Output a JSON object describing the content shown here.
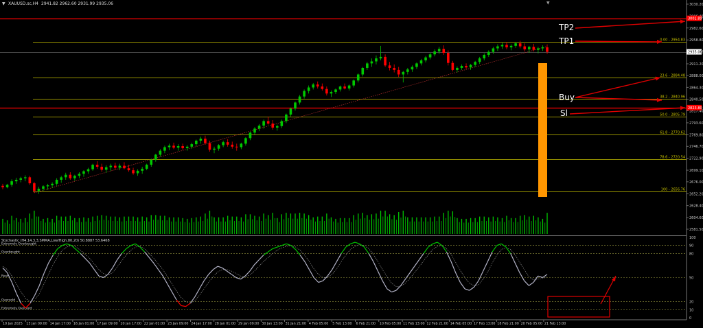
{
  "header": {
    "symbol_text": "XAUUSD.sc,H4",
    "ohlc_text": "2941.82 2962.60 2931.99 2935.06"
  },
  "chart_data": {
    "type": "candlestick",
    "price_axis": {
      "ticks": [
        "3030.20",
        "3006.40",
        "2982.60",
        "2958.80",
        "2935.06",
        "2911.20",
        "2888.00",
        "2864.30",
        "2840.50",
        "2817.40",
        "2793.60",
        "2769.80",
        "2746.70",
        "2722.90",
        "2699.10",
        "2676.00",
        "2652.20",
        "2628.40",
        "2604.60",
        "2581.50"
      ]
    },
    "current_price_label": "2935.06",
    "tp2_price_label": "3001.89",
    "sl_price_label": "2823.80",
    "fib_levels": [
      {
        "label": "0.00 - 2954.83",
        "price": 2954.8
      },
      {
        "label": "23.6 - 2884.48",
        "price": 2884.5
      },
      {
        "label": "38.2 - 2840.96",
        "price": 2840.96
      },
      {
        "label": "50.0 - 2805.79",
        "price": 2805.8
      },
      {
        "label": "61.8 - 2770.62",
        "price": 2770.6
      },
      {
        "label": "78.6 - 2720.54",
        "price": 2720.5
      },
      {
        "label": "100 - 2656.76",
        "price": 2656.8
      }
    ],
    "time_axis": {
      "labels": [
        "10 Jan 2025",
        "13 Jan 09:00",
        "14 Jan 17:00",
        "16 Jan 01:00",
        "17 Jan 09:00",
        "20 Jan 17:00",
        "22 Jan 01:00",
        "23 Jan 09:00",
        "24 Jan 17:00",
        "28 Jan 01:00",
        "29 Jan 09:00",
        "30 Jan 13:00",
        "31 Jan 21:00",
        "4 Feb 05:00",
        "5 Feb 13:00",
        "6 Feb 21:00",
        "10 Feb 05:00",
        "11 Feb 13:00",
        "12 Feb 21:00",
        "14 Feb 05:00",
        "17 Feb 13:00",
        "18 Feb 21:00",
        "20 Feb 05:00",
        "21 Feb 13:00"
      ]
    },
    "candles": [
      [
        2668,
        2672,
        2661,
        2665
      ],
      [
        2665,
        2672,
        2663,
        2670
      ],
      [
        2670,
        2681,
        2666,
        2677
      ],
      [
        2677,
        2684,
        2672,
        2680
      ],
      [
        2680,
        2686,
        2675,
        2683
      ],
      [
        2683,
        2689,
        2677,
        2685
      ],
      [
        2685,
        2688,
        2670,
        2673
      ],
      [
        2673,
        2676,
        2654,
        2658
      ],
      [
        2658,
        2666,
        2652,
        2662
      ],
      [
        2662,
        2669,
        2658,
        2667
      ],
      [
        2667,
        2672,
        2660,
        2669
      ],
      [
        2669,
        2675,
        2664,
        2672
      ],
      [
        2672,
        2683,
        2668,
        2680
      ],
      [
        2680,
        2688,
        2674,
        2685
      ],
      [
        2685,
        2694,
        2680,
        2690
      ],
      [
        2690,
        2695,
        2680,
        2683
      ],
      [
        2683,
        2690,
        2678,
        2688
      ],
      [
        2688,
        2695,
        2683,
        2692
      ],
      [
        2692,
        2699,
        2686,
        2697
      ],
      [
        2697,
        2704,
        2692,
        2701
      ],
      [
        2701,
        2712,
        2698,
        2710
      ],
      [
        2710,
        2717,
        2702,
        2706
      ],
      [
        2706,
        2712,
        2696,
        2700
      ],
      [
        2700,
        2709,
        2694,
        2705
      ],
      [
        2705,
        2712,
        2698,
        2708
      ],
      [
        2708,
        2714,
        2700,
        2704
      ],
      [
        2704,
        2712,
        2699,
        2708
      ],
      [
        2708,
        2715,
        2701,
        2703
      ],
      [
        2703,
        2710,
        2696,
        2699
      ],
      [
        2699,
        2704,
        2690,
        2693
      ],
      [
        2693,
        2701,
        2688,
        2698
      ],
      [
        2698,
        2706,
        2692,
        2702
      ],
      [
        2702,
        2712,
        2699,
        2710
      ],
      [
        2710,
        2722,
        2706,
        2720
      ],
      [
        2720,
        2732,
        2716,
        2730
      ],
      [
        2730,
        2741,
        2726,
        2738
      ],
      [
        2738,
        2748,
        2733,
        2745
      ],
      [
        2745,
        2752,
        2739,
        2748
      ],
      [
        2748,
        2754,
        2741,
        2744
      ],
      [
        2744,
        2751,
        2738,
        2747
      ],
      [
        2747,
        2752,
        2740,
        2743
      ],
      [
        2743,
        2749,
        2738,
        2746
      ],
      [
        2746,
        2754,
        2742,
        2751
      ],
      [
        2751,
        2760,
        2747,
        2758
      ],
      [
        2758,
        2766,
        2752,
        2762
      ],
      [
        2762,
        2768,
        2750,
        2753
      ],
      [
        2753,
        2758,
        2736,
        2740
      ],
      [
        2740,
        2746,
        2733,
        2742
      ],
      [
        2742,
        2751,
        2738,
        2749
      ],
      [
        2749,
        2758,
        2745,
        2755
      ],
      [
        2755,
        2761,
        2746,
        2750
      ],
      [
        2750,
        2756,
        2742,
        2746
      ],
      [
        2746,
        2752,
        2738,
        2745
      ],
      [
        2745,
        2754,
        2741,
        2752
      ],
      [
        2752,
        2765,
        2748,
        2763
      ],
      [
        2763,
        2776,
        2759,
        2774
      ],
      [
        2774,
        2785,
        2770,
        2782
      ],
      [
        2782,
        2791,
        2777,
        2788
      ],
      [
        2788,
        2800,
        2782,
        2797
      ],
      [
        2797,
        2806,
        2790,
        2792
      ],
      [
        2792,
        2799,
        2780,
        2784
      ],
      [
        2784,
        2790,
        2778,
        2787
      ],
      [
        2787,
        2800,
        2783,
        2797
      ],
      [
        2797,
        2812,
        2793,
        2810
      ],
      [
        2810,
        2824,
        2806,
        2822
      ],
      [
        2822,
        2836,
        2818,
        2834
      ],
      [
        2834,
        2849,
        2830,
        2846
      ],
      [
        2846,
        2860,
        2842,
        2857
      ],
      [
        2857,
        2868,
        2852,
        2864
      ],
      [
        2864,
        2873,
        2860,
        2870
      ],
      [
        2870,
        2876,
        2862,
        2866
      ],
      [
        2866,
        2872,
        2858,
        2861
      ],
      [
        2861,
        2866,
        2848,
        2852
      ],
      [
        2852,
        2858,
        2845,
        2855
      ],
      [
        2855,
        2862,
        2851,
        2860
      ],
      [
        2860,
        2868,
        2856,
        2866
      ],
      [
        2866,
        2872,
        2860,
        2862
      ],
      [
        2862,
        2870,
        2858,
        2868
      ],
      [
        2868,
        2880,
        2864,
        2878
      ],
      [
        2878,
        2892,
        2874,
        2890
      ],
      [
        2890,
        2905,
        2886,
        2903
      ],
      [
        2903,
        2915,
        2899,
        2912
      ],
      [
        2912,
        2922,
        2905,
        2916
      ],
      [
        2916,
        2928,
        2910,
        2922
      ],
      [
        2922,
        2947,
        2918,
        2925
      ],
      [
        2925,
        2930,
        2905,
        2908
      ],
      [
        2908,
        2915,
        2898,
        2903
      ],
      [
        2903,
        2910,
        2894,
        2899
      ],
      [
        2899,
        2905,
        2885,
        2890
      ],
      [
        2890,
        2897,
        2874,
        2895
      ],
      [
        2895,
        2903,
        2890,
        2900
      ],
      [
        2900,
        2908,
        2895,
        2905
      ],
      [
        2905,
        2914,
        2901,
        2912
      ],
      [
        2912,
        2921,
        2908,
        2918
      ],
      [
        2918,
        2927,
        2914,
        2924
      ],
      [
        2924,
        2933,
        2920,
        2930
      ],
      [
        2930,
        2940,
        2926,
        2936
      ],
      [
        2936,
        2945,
        2931,
        2941
      ],
      [
        2941,
        2948,
        2929,
        2933
      ],
      [
        2933,
        2938,
        2908,
        2913
      ],
      [
        2913,
        2917,
        2896,
        2899
      ],
      [
        2899,
        2906,
        2894,
        2903
      ],
      [
        2903,
        2910,
        2899,
        2907
      ],
      [
        2907,
        2912,
        2901,
        2904
      ],
      [
        2904,
        2911,
        2899,
        2909
      ],
      [
        2909,
        2917,
        2905,
        2915
      ],
      [
        2915,
        2925,
        2911,
        2922
      ],
      [
        2922,
        2932,
        2918,
        2929
      ],
      [
        2929,
        2938,
        2925,
        2935
      ],
      [
        2935,
        2945,
        2931,
        2942
      ],
      [
        2942,
        2950,
        2937,
        2946
      ],
      [
        2946,
        2953,
        2941,
        2949
      ],
      [
        2949,
        2955,
        2940,
        2944
      ],
      [
        2944,
        2950,
        2938,
        2947
      ],
      [
        2947,
        2955,
        2943,
        2952
      ],
      [
        2952,
        2957,
        2942,
        2946
      ],
      [
        2946,
        2952,
        2936,
        2940
      ],
      [
        2940,
        2947,
        2933,
        2945
      ],
      [
        2945,
        2951,
        2936,
        2939
      ],
      [
        2939,
        2945,
        2932,
        2942
      ],
      [
        2942,
        2948,
        2937,
        2944
      ],
      [
        2944,
        2950,
        2931,
        2935
      ]
    ],
    "stochastic": {
      "label": "Stochastic (H4,14,3,3,SMMA,Low/High,80,20) 50.8887 53.6468",
      "k": [
        62,
        56,
        44,
        30,
        18,
        12,
        18,
        28,
        40,
        55,
        68,
        78,
        86,
        90,
        92,
        90,
        85,
        80,
        74,
        68,
        60,
        52,
        50,
        54,
        62,
        72,
        80,
        86,
        90,
        92,
        88,
        82,
        75,
        68,
        60,
        52,
        42,
        32,
        22,
        15,
        14,
        18,
        26,
        36,
        46,
        54,
        60,
        64,
        62,
        58,
        54,
        50,
        48,
        52,
        58,
        66,
        72,
        78,
        82,
        86,
        88,
        90,
        92,
        90,
        85,
        78,
        70,
        60,
        50,
        44,
        46,
        52,
        60,
        70,
        80,
        88,
        92,
        94,
        92,
        88,
        80,
        70,
        58,
        46,
        36,
        32,
        34,
        40,
        48,
        56,
        64,
        72,
        80,
        88,
        92,
        94,
        90,
        82,
        70,
        56,
        44,
        36,
        34,
        38,
        46,
        58,
        70,
        82,
        90,
        92,
        88,
        80,
        68,
        56,
        46,
        40,
        44,
        52,
        50,
        54
      ],
      "d": [
        64,
        60,
        52,
        42,
        32,
        24,
        20,
        22,
        30,
        42,
        54,
        66,
        76,
        84,
        88,
        90,
        88,
        84,
        79,
        74,
        67,
        60,
        55,
        53,
        56,
        63,
        71,
        78,
        84,
        88,
        89,
        86,
        80,
        74,
        67,
        60,
        51,
        42,
        33,
        25,
        20,
        18,
        21,
        28,
        36,
        44,
        51,
        57,
        60,
        60,
        58,
        55,
        52,
        51,
        53,
        58,
        64,
        70,
        75,
        80,
        84,
        87,
        89,
        90,
        88,
        84,
        78,
        70,
        61,
        54,
        50,
        50,
        54,
        61,
        70,
        78,
        85,
        89,
        91,
        90,
        86,
        79,
        70,
        60,
        51,
        43,
        39,
        39,
        43,
        49,
        56,
        63,
        71,
        78,
        85,
        89,
        90,
        86,
        79,
        69,
        59,
        50,
        43,
        40,
        41,
        48,
        57,
        68,
        78,
        85,
        87,
        85,
        78,
        69,
        60,
        51,
        47,
        48,
        49,
        51
      ],
      "levels": [
        {
          "value": 90,
          "label": "Extremely Overbought"
        },
        {
          "value": 80,
          "label": "Overbought"
        },
        {
          "value": 50,
          "label": "Rest"
        },
        {
          "value": 20,
          "label": "Oversold"
        },
        {
          "value": 10,
          "label": "Extremely Oversold"
        }
      ],
      "axis_ticks": [
        "100",
        "90",
        "80",
        "50",
        "20",
        "10",
        "0"
      ]
    }
  },
  "annotations": {
    "tp2": "TP2",
    "tp1": "TP1",
    "buy": "Buy",
    "sl": "Sl"
  },
  "colors": {
    "bull": "#00c800",
    "bear": "#ff0000",
    "fib": "#c9c200",
    "sr_line": "#ff0000",
    "orange_bar": "#ff9600",
    "stoch_k_high": "#00c800",
    "stoch_k_low": "#ff0000",
    "stoch_k_mid": "#b4b4c8"
  }
}
